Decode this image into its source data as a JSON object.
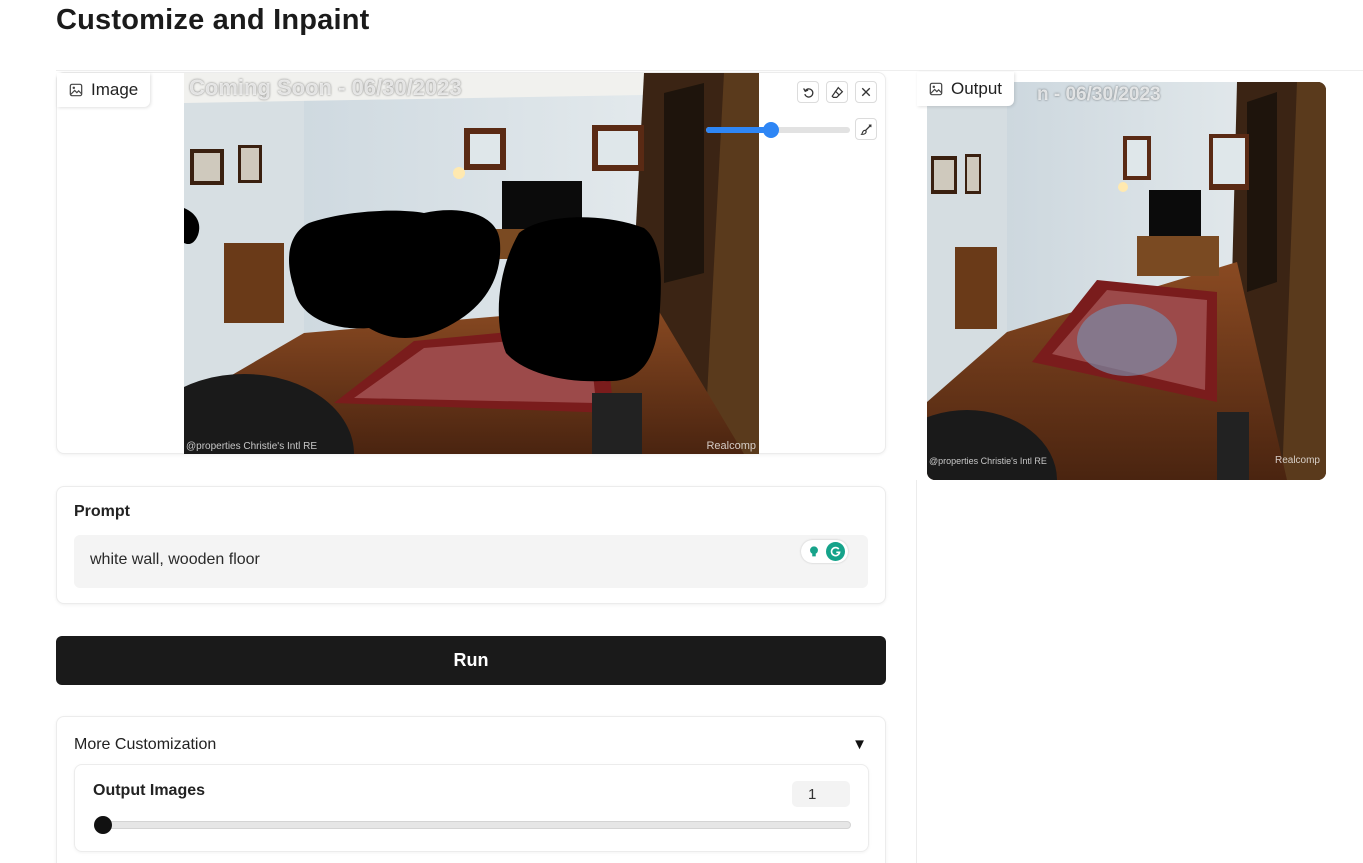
{
  "page": {
    "title": "Customize and Inpaint"
  },
  "image_input": {
    "label": "Image",
    "watermark_top": "Coming Soon - 06/30/2023",
    "watermark_bottom_left": "@properties Christie's Intl RE",
    "watermark_bottom_right": "Realcomp",
    "tools": {
      "undo": "undo-icon",
      "eraser": "eraser-icon",
      "clear": "close-icon",
      "brush": "brush-icon"
    },
    "brush_size_fraction": 0.45,
    "accent_color": "#2e86f5"
  },
  "output": {
    "label": "Output",
    "watermark_top": "n - 06/30/2023",
    "watermark_bottom_left": "@properties Christie's Intl RE",
    "watermark_bottom_right": "Realcomp"
  },
  "prompt": {
    "label": "Prompt",
    "value": "white wall, wooden floor"
  },
  "run_button": {
    "label": "Run"
  },
  "more_customization": {
    "label": "More Customization",
    "caret": "▼",
    "output_images": {
      "label": "Output Images",
      "value": "1"
    }
  }
}
